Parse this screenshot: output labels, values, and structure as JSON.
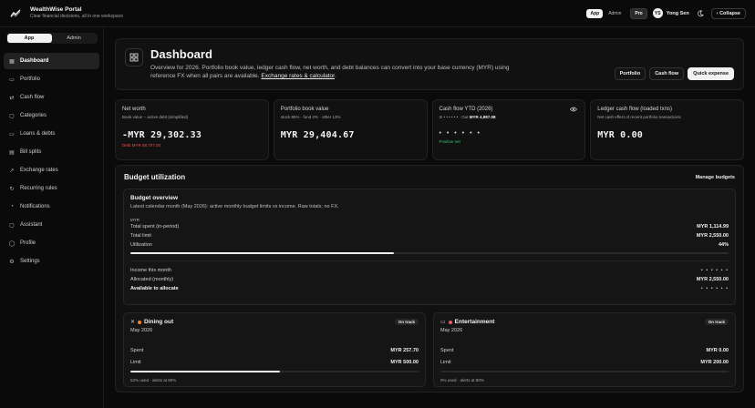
{
  "app": {
    "title": "WealthWise Portal",
    "subtitle": "Clear financial decisions, all in one workspace"
  },
  "topbar": {
    "mode_app": "App",
    "mode_admin": "Admin",
    "plan_badge": "Pro",
    "user_name": "Yong Sen",
    "user_initials": "YS",
    "collapse_label": "Collapse"
  },
  "sidebar": {
    "switch_app": "App",
    "switch_admin": "Admin",
    "items": [
      {
        "label": "Dashboard",
        "icon": "grid-icon",
        "glyph": "▦"
      },
      {
        "label": "Portfolio",
        "icon": "folder-icon",
        "glyph": "▭"
      },
      {
        "label": "Cash flow",
        "icon": "swap-icon",
        "glyph": "⇄"
      },
      {
        "label": "Categories",
        "icon": "tag-icon",
        "glyph": "▢"
      },
      {
        "label": "Loans & debts",
        "icon": "card-icon",
        "glyph": "▭"
      },
      {
        "label": "Bill splits",
        "icon": "receipt-icon",
        "glyph": "▤"
      },
      {
        "label": "Exchange rates",
        "icon": "trend-icon",
        "glyph": "↗"
      },
      {
        "label": "Recurring rules",
        "icon": "repeat-icon",
        "glyph": "↻"
      },
      {
        "label": "Notifications",
        "icon": "bell-icon",
        "glyph": "◔"
      },
      {
        "label": "Assistant",
        "icon": "chat-icon",
        "glyph": "▢"
      },
      {
        "label": "Profile",
        "icon": "user-icon",
        "glyph": "◯"
      },
      {
        "label": "Settings",
        "icon": "gear-icon",
        "glyph": "⚙"
      }
    ]
  },
  "hero": {
    "title": "Dashboard",
    "description": "Overview for 2026. Portfolio book value, ledger cash flow, net worth, and debt balances can convert into your base currency (MYR) using reference FX when all pairs are available.",
    "link": "Exchange rates & calculator",
    "link_suffix": ".",
    "btn_portfolio": "Portfolio",
    "btn_cashflow": "Cash flow",
    "btn_quick": "Quick expense"
  },
  "stats": {
    "net_worth": {
      "title": "Net worth",
      "sub": "Book value − active debt (simplified)",
      "value": "-MYR 29,302.33",
      "foot": "Debt MYR 58,707.00"
    },
    "portfolio": {
      "title": "Portfolio book value",
      "sub": "stock 85% · fund 2% · other 13%",
      "value": "MYR 29,404.67"
    },
    "cashflow": {
      "title": "Cash flow YTD (2026)",
      "sub_in": "In • • • • • • ·",
      "sub_out": "Out",
      "sub_out_val": "MYR 4,987.08",
      "value": "• • • • • •",
      "foot": "Positive net"
    },
    "ledger": {
      "title": "Ledger cash flow (loaded txns)",
      "sub": "Net cash effect of recent portfolio transactions",
      "value": "MYR 0.00"
    }
  },
  "budget": {
    "title": "Budget utilization",
    "manage": "Manage budgets",
    "overview": {
      "title": "Budget overview",
      "desc": "Latest calendar month (May 2026): active monthly budget limits vs income. Raw totals; no FX.",
      "currency": "MYR",
      "spent_label": "Total spent (in-period)",
      "spent_value": "MYR 1,114.99",
      "limit_label": "Total limit",
      "limit_value": "MYR 2,550.00",
      "util_label": "Utilization",
      "util_value": "44%",
      "util_fraction": 0.44,
      "income_label": "Income this month",
      "income_value": "• • • • • •",
      "allocated_label": "Allocated (monthly)",
      "allocated_value": "MYR 2,550.00",
      "available_label": "Available to allocate",
      "available_value": "• • • • • •"
    },
    "categories": [
      {
        "name": "Dining out",
        "icon": "utensils-icon",
        "glyph": "✕",
        "dot": "#f0832a",
        "status": "On track",
        "month": "May 2026",
        "spent_label": "Spent",
        "spent": "MYR 257.70",
        "limit_label": "Limit",
        "limit": "MYR 500.00",
        "used_fraction": 0.52,
        "foot": "52% used · alerts at 80%"
      },
      {
        "name": "Entertainment",
        "icon": "ticket-icon",
        "glyph": "▭",
        "dot": "#e05a6a",
        "status": "On track",
        "month": "May 2026",
        "spent_label": "Spent",
        "spent": "MYR 0.00",
        "limit_label": "Limit",
        "limit": "MYR 200.00",
        "used_fraction": 0.0,
        "foot": "0% used · alerts at 80%"
      }
    ]
  },
  "colors": {
    "background": "#0a0a0a",
    "card": "#111111",
    "negative": "#ef4f4f",
    "positive": "#36c37a"
  }
}
